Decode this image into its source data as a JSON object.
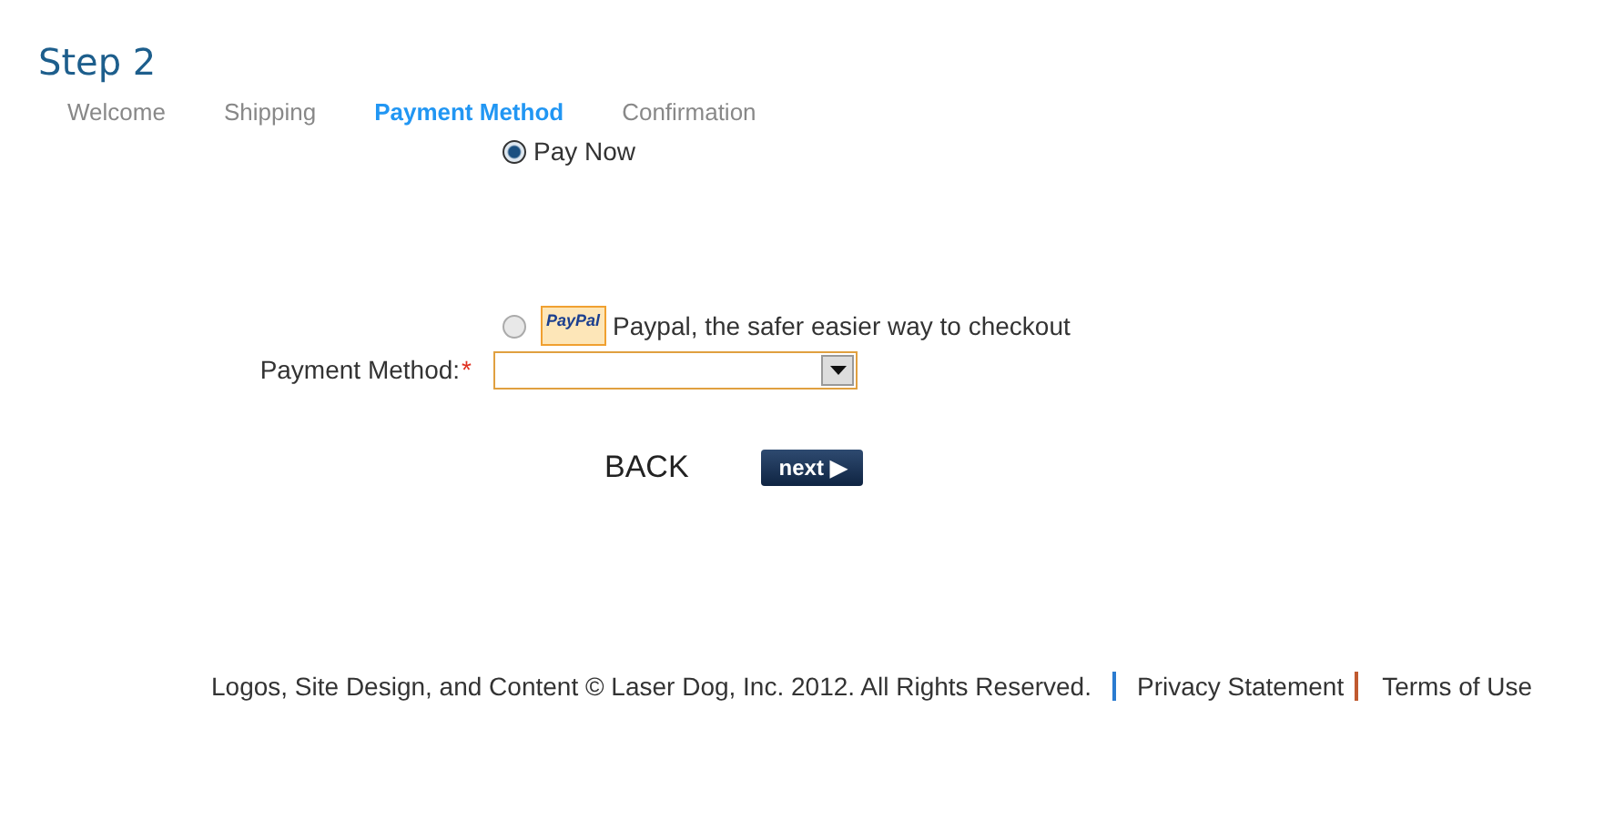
{
  "title": "Step 2",
  "steps": [
    {
      "label": "Welcome",
      "selected": false
    },
    {
      "label": "Shipping",
      "selected": false
    },
    {
      "label": "Payment Method",
      "selected": true
    },
    {
      "label": "Confirmation",
      "selected": false
    }
  ],
  "options": [
    {
      "label": "Pay Now",
      "selected": true
    },
    {
      "label": "Paypal, the safer easier way to checkout",
      "logo": "PayPal",
      "selected": false
    }
  ],
  "payment_method": {
    "label": "Payment Method:",
    "required_mark": "*"
  },
  "buttons": {
    "back": "BACK",
    "next": "next ▶"
  },
  "footer": {
    "copyright": "Logos, Site Design, and Content © Laser Dog, Inc. 2012. All Rights Reserved.",
    "links": [
      "Privacy Statement",
      "Terms of Use"
    ]
  }
}
